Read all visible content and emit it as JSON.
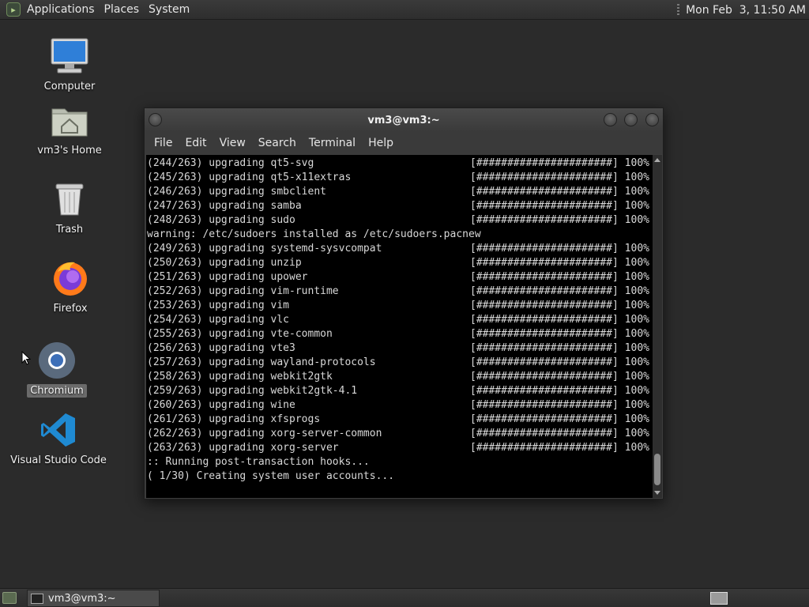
{
  "top_panel": {
    "menus": [
      "Applications",
      "Places",
      "System"
    ],
    "clock": "Mon Feb  3, 11:50 AM"
  },
  "desktop_icons": [
    {
      "label": "Computer",
      "icon": "computer-icon"
    },
    {
      "label": "vm3's Home",
      "icon": "home-folder-icon"
    },
    {
      "label": "Trash",
      "icon": "trash-icon"
    },
    {
      "label": "Firefox",
      "icon": "firefox-icon"
    },
    {
      "label": "Chromium",
      "icon": "chromium-icon"
    },
    {
      "label": "Visual Studio Code",
      "icon": "vscode-icon"
    }
  ],
  "terminal": {
    "title": "vm3@vm3:~",
    "menu": [
      "File",
      "Edit",
      "View",
      "Search",
      "Terminal",
      "Help"
    ],
    "progress_bar": "[######################]",
    "percent": "100%",
    "lines": [
      {
        "text": "(244/263) upgrading qt5-svg",
        "progress": true
      },
      {
        "text": "(245/263) upgrading qt5-x11extras",
        "progress": true
      },
      {
        "text": "(246/263) upgrading smbclient",
        "progress": true
      },
      {
        "text": "(247/263) upgrading samba",
        "progress": true
      },
      {
        "text": "(248/263) upgrading sudo",
        "progress": true
      },
      {
        "text": "warning: /etc/sudoers installed as /etc/sudoers.pacnew",
        "progress": false
      },
      {
        "text": "(249/263) upgrading systemd-sysvcompat",
        "progress": true
      },
      {
        "text": "(250/263) upgrading unzip",
        "progress": true
      },
      {
        "text": "(251/263) upgrading upower",
        "progress": true
      },
      {
        "text": "(252/263) upgrading vim-runtime",
        "progress": true
      },
      {
        "text": "(253/263) upgrading vim",
        "progress": true
      },
      {
        "text": "(254/263) upgrading vlc",
        "progress": true
      },
      {
        "text": "(255/263) upgrading vte-common",
        "progress": true
      },
      {
        "text": "(256/263) upgrading vte3",
        "progress": true
      },
      {
        "text": "(257/263) upgrading wayland-protocols",
        "progress": true
      },
      {
        "text": "(258/263) upgrading webkit2gtk",
        "progress": true
      },
      {
        "text": "(259/263) upgrading webkit2gtk-4.1",
        "progress": true
      },
      {
        "text": "(260/263) upgrading wine",
        "progress": true
      },
      {
        "text": "(261/263) upgrading xfsprogs",
        "progress": true
      },
      {
        "text": "(262/263) upgrading xorg-server-common",
        "progress": true
      },
      {
        "text": "(263/263) upgrading xorg-server",
        "progress": true
      },
      {
        "text": ":: Running post-transaction hooks...",
        "progress": false
      },
      {
        "text": "( 1/30) Creating system user accounts...",
        "progress": false
      }
    ]
  },
  "taskbar": {
    "task_label": "vm3@vm3:~"
  }
}
